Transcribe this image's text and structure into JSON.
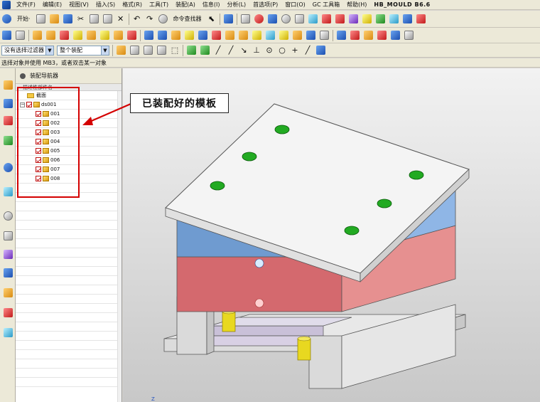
{
  "menubar": {
    "items": [
      "文件(F)",
      "编辑(E)",
      "视图(V)",
      "插入(S)",
      "格式(R)",
      "工具(T)",
      "装配(A)",
      "信息(I)",
      "分析(L)",
      "首选项(P)",
      "窗口(O)",
      "GC 工具箱",
      "帮助(H)",
      "HB_MOULD B6.6"
    ]
  },
  "toolbar1": {
    "start_label": "开始·",
    "command_finder_label": "命令查找器"
  },
  "toolbar3": {
    "selection_filter": "没有选择过滤器",
    "assembly_scope": "整个装配"
  },
  "status": {
    "prompt": "选择对象并使用 MB3，或者双击某一对象"
  },
  "navigator": {
    "title": "装配导航器",
    "column_header": "描述性部件名",
    "section_label": "截面",
    "root_label": "ds001",
    "children": [
      "001",
      "002",
      "003",
      "004",
      "005",
      "006",
      "007",
      "008"
    ]
  },
  "annotation": {
    "callout_text": "已装配好的模板"
  },
  "viewport": {
    "axis_label": "Z"
  },
  "colors": {
    "plate_top": "#f4f4f4",
    "plate_blue": "#6f9bd0",
    "plate_red": "#d4696e",
    "plate_gray": "#d8d8d8",
    "hole_green": "#22aa22",
    "pillar_yellow": "#e8d820",
    "highlight_red": "#d40000"
  }
}
